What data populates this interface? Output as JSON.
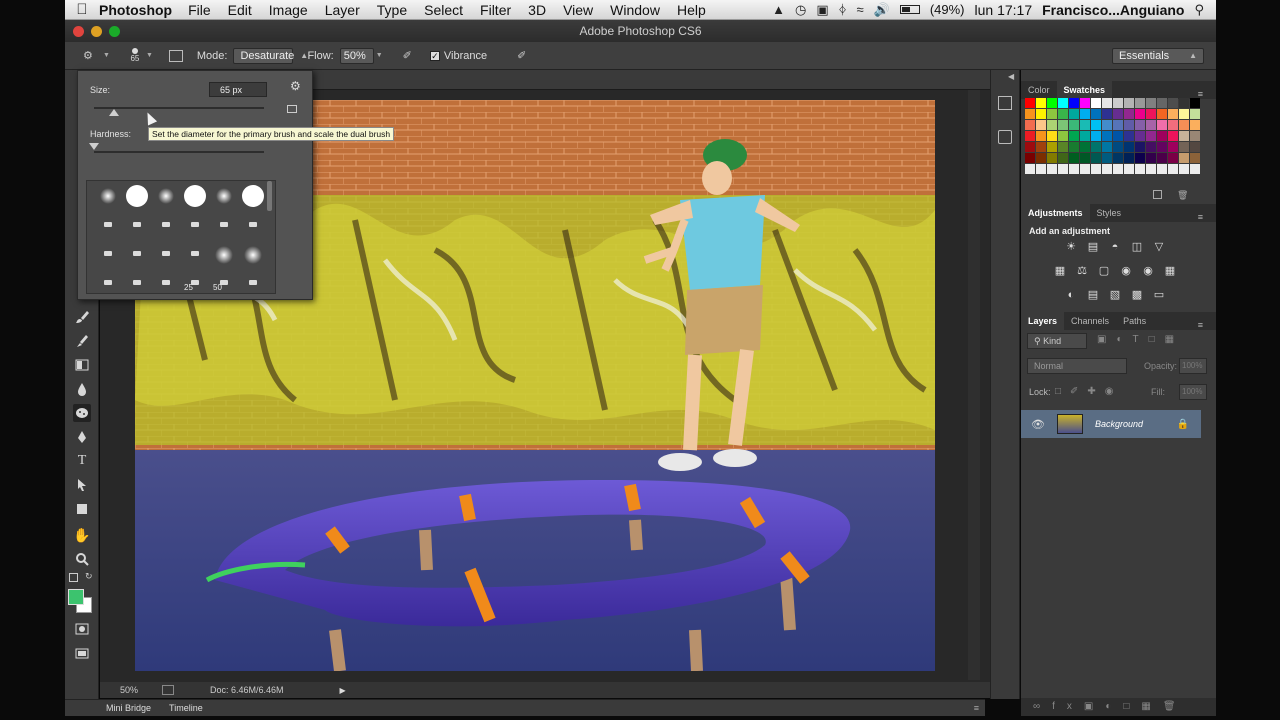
{
  "menubar": {
    "app_name": "Photoshop",
    "items": [
      "File",
      "Edit",
      "Image",
      "Layer",
      "Type",
      "Select",
      "Filter",
      "3D",
      "View",
      "Window",
      "Help"
    ],
    "battery": "(49%)",
    "clock": "lun 17:17",
    "user": "Francisco...Anguiano"
  },
  "window": {
    "title": "Adobe Photoshop CS6"
  },
  "options": {
    "brush_size": "65",
    "mode_label": "Mode:",
    "mode_value": "Desaturate",
    "flow_label": "Flow:",
    "flow_value": "50%",
    "vibrance_label": "Vibrance",
    "workspace": "Essentials"
  },
  "brush_popup": {
    "size_label": "Size:",
    "size_value": "65 px",
    "size_fraction": 0.12,
    "hardness_label": "Hardness:",
    "hardness_fraction": 0.0,
    "tooltip": "Set the diameter for the primary brush and scale the dual brush",
    "tip_numbers": [
      "25",
      "50"
    ]
  },
  "status": {
    "zoom": "50%",
    "doc": "Doc: 6.46M/6.46M"
  },
  "bottom_tabs": [
    "Mini Bridge",
    "Timeline"
  ],
  "panels": {
    "color_tabs": [
      "Color",
      "Swatches"
    ],
    "adjust_tabs": [
      "Adjustments",
      "Styles"
    ],
    "add_adjustment": "Add an adjustment",
    "layer_tabs": [
      "Layers",
      "Channels",
      "Paths"
    ],
    "kind": "Kind",
    "blend": "Normal",
    "opacity_label": "Opacity:",
    "opacity_value": "100%",
    "lock_label": "Lock:",
    "fill_label": "Fill:",
    "fill_value": "100%",
    "layer_name": "Background"
  },
  "colors": {
    "foreground": "#3cc36e",
    "background": "#ffffff",
    "selected_layer": "#5a6d84"
  }
}
